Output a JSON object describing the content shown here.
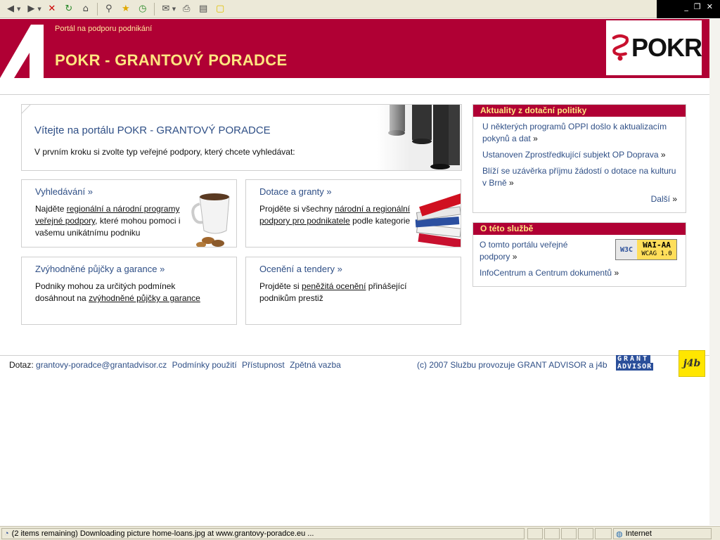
{
  "browser": {
    "status_text": "(2 items remaining) Downloading picture home-loans.jpg at www.grantovy-poradce.eu ...",
    "zone": "Internet"
  },
  "header": {
    "tagline": "Portál na podporu podnikání",
    "title": "POKR - GRANTOVÝ PORADCE",
    "logo_text": "POKR"
  },
  "welcome": {
    "title": "Vítejte na portálu POKR - GRANTOVÝ PORADCE",
    "text": "V prvním kroku si zvolte typ veřejné podpory, který chcete vyhledávat:"
  },
  "cards": [
    {
      "title": "Vyhledávání",
      "pre": "Najděte ",
      "link": "regionální a národní programy veřejné podpory",
      "post": ", které mohou pomoci i vašemu unikátnímu podniku"
    },
    {
      "title": "Dotace a granty",
      "pre": "Projděte si všechny ",
      "link": "národní a regionální podpory pro podnikatele",
      "post": " podle kategorie"
    },
    {
      "title": "Zvýhodněné půjčky a garance",
      "pre": "Podniky mohou za určitých podmínek dosáhnout na ",
      "link": "zvýhodněné půjčky a garance",
      "post": ""
    },
    {
      "title": "Ocenění a tendery",
      "pre": "Projděte si ",
      "link": "peněžitá ocenění",
      "post": " přinášející podnikům prestiž"
    }
  ],
  "card_arrow": "»",
  "news": {
    "heading": "Aktuality z dotační politiky",
    "items": [
      "U některých programů OPPI došlo k aktualizacím pokynů a dat",
      "Ustanoven Zprostředkující subjekt OP Doprava",
      "Blíží se uzávěrka příjmu žádostí o dotace na kulturu v Brně"
    ],
    "more": "Další"
  },
  "about": {
    "heading": "O této službě",
    "items": [
      "O tomto portálu veřejné podpory",
      "InfoCentrum a Centrum dokumentů"
    ],
    "badge_w3c": "W3C",
    "badge_wai": "WAI-AA",
    "badge_wcag": "WCAG 1.0"
  },
  "footer": {
    "label": "Dotaz:",
    "email": "grantovy-poradce@grantadvisor.cz",
    "links": [
      "Podmínky použití",
      "Přístupnost",
      "Zpětná vazba"
    ],
    "copyright": "(c) 2007 Službu provozuje GRANT ADVISOR a j4b",
    "ga_logo_line1": "GRANT",
    "ga_logo_line2": "ADVISOR",
    "j4b_logo": "j4b"
  },
  "colors": {
    "brand_red": "#b00034",
    "title_yellow": "#ffe680",
    "link_blue": "#2f4f86"
  }
}
